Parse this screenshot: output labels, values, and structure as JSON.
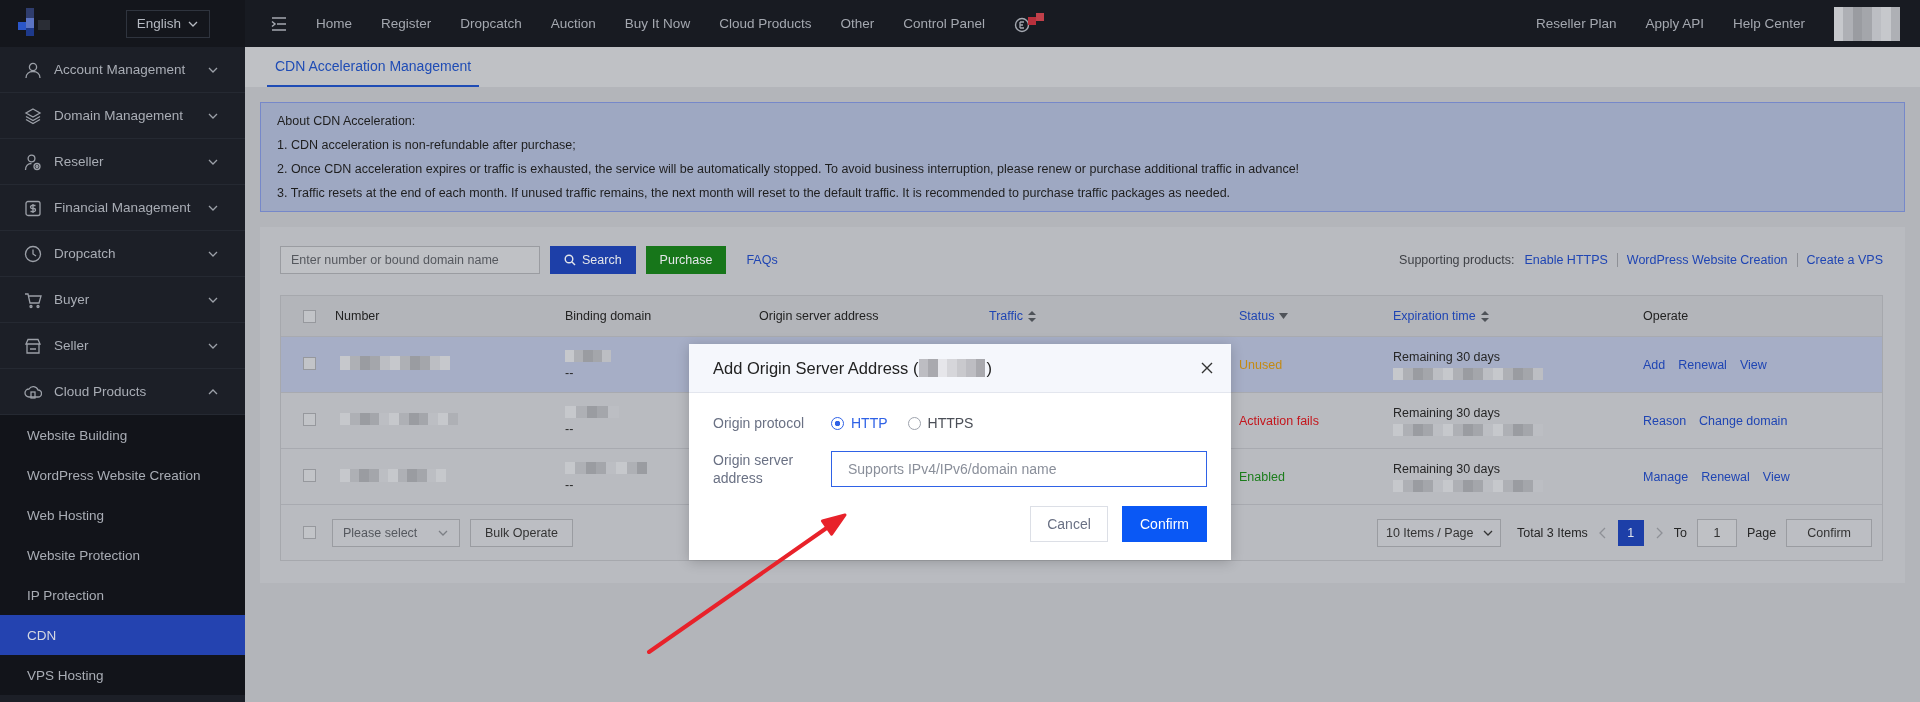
{
  "top_bar": {
    "language": "English",
    "nav": [
      "Home",
      "Register",
      "Dropcatch",
      "Auction",
      "Buy It Now",
      "Cloud Products",
      "Other",
      "Control Panel"
    ],
    "right_links": [
      "Reseller Plan",
      "Apply API",
      "Help Center"
    ]
  },
  "sidebar": {
    "items": [
      {
        "label": "Account Management",
        "expanded": false
      },
      {
        "label": "Domain Management",
        "expanded": false
      },
      {
        "label": "Reseller",
        "expanded": false
      },
      {
        "label": "Financial Management",
        "expanded": false
      },
      {
        "label": "Dropcatch",
        "expanded": false
      },
      {
        "label": "Buyer",
        "expanded": false
      },
      {
        "label": "Seller",
        "expanded": false
      },
      {
        "label": "Cloud Products",
        "expanded": true,
        "children": [
          {
            "label": "Website Building",
            "selected": false
          },
          {
            "label": "WordPress Website Creation",
            "selected": false
          },
          {
            "label": "Web Hosting",
            "selected": false
          },
          {
            "label": "Website Protection",
            "selected": false
          },
          {
            "label": "IP Protection",
            "selected": false
          },
          {
            "label": "CDN",
            "selected": true
          },
          {
            "label": "VPS Hosting",
            "selected": false
          }
        ]
      }
    ]
  },
  "page_tabs": [
    {
      "label": "CDN Acceleration Management",
      "selected": true
    }
  ],
  "notice": {
    "title": "About CDN Acceleration:",
    "lines": [
      "1. CDN acceleration is non-refundable after purchase;",
      "2. Once CDN acceleration expires or traffic is exhausted, the service will be automatically stopped. To avoid business interruption, please renew or purchase additional traffic in advance!",
      "3. Traffic resets at the end of each month. If unused traffic remains, the next month will reset to the default traffic. It is recommended to purchase traffic packages as needed."
    ]
  },
  "toolbar": {
    "search_placeholder": "Enter number or bound domain name",
    "search_button": "Search",
    "purchase_button": "Purchase",
    "faqs_link": "FAQs",
    "supporting_label": "Supporting products:",
    "supporting_links": [
      "Enable HTTPS",
      "WordPress Website Creation",
      "Create a VPS"
    ]
  },
  "table": {
    "header_checked": false,
    "columns": [
      {
        "label": "Number",
        "kind": "plain"
      },
      {
        "label": "Binding domain",
        "kind": "plain"
      },
      {
        "label": "Origin server address",
        "kind": "plain"
      },
      {
        "label": "Traffic",
        "kind": "sortable"
      },
      {
        "label": "Status",
        "kind": "filter"
      },
      {
        "label": "Expiration time",
        "kind": "sortable"
      },
      {
        "label": "Operate",
        "kind": "plain"
      }
    ],
    "rows": [
      {
        "checked": false,
        "hovered": true,
        "binding_domain_note": "--",
        "status": {
          "text": "Unused",
          "color": "#c48a12"
        },
        "expiration": "Remaining 30 days",
        "actions": [
          "Add",
          "Renewal",
          "View"
        ]
      },
      {
        "checked": false,
        "hovered": false,
        "binding_domain_note": "--",
        "status": {
          "text": "Activation fails",
          "color": "#c4161c"
        },
        "expiration": "Remaining 30 days",
        "actions": [
          "Reason",
          "Change domain"
        ]
      },
      {
        "checked": false,
        "hovered": false,
        "binding_domain_note": "--",
        "status": {
          "text": "Enabled",
          "color": "#1b7d1b"
        },
        "expiration": "Remaining 30 days",
        "actions": [
          "Manage",
          "Renewal",
          "View"
        ]
      }
    ],
    "footer": {
      "checked": false,
      "bulk_select_placeholder": "Please select",
      "bulk_button": "Bulk Operate",
      "page_size": "10 Items / Page",
      "total": "Total 3 Items",
      "pages": [
        {
          "label": "1",
          "selected": true
        }
      ],
      "to_label": "To",
      "jump_value": "1",
      "page_label": "Page",
      "confirm_button": "Confirm"
    }
  },
  "modal": {
    "title_start": "Add Origin Server Address (",
    "title_end": ")",
    "protocol_label": "Origin protocol",
    "protocols": [
      {
        "label": "HTTP",
        "selected": true
      },
      {
        "label": "HTTPS",
        "selected": false
      }
    ],
    "address_label": "Origin server address",
    "address_placeholder": "Supports IPv4/IPv6/domain name",
    "cancel_button": "Cancel",
    "confirm_button": "Confirm"
  }
}
